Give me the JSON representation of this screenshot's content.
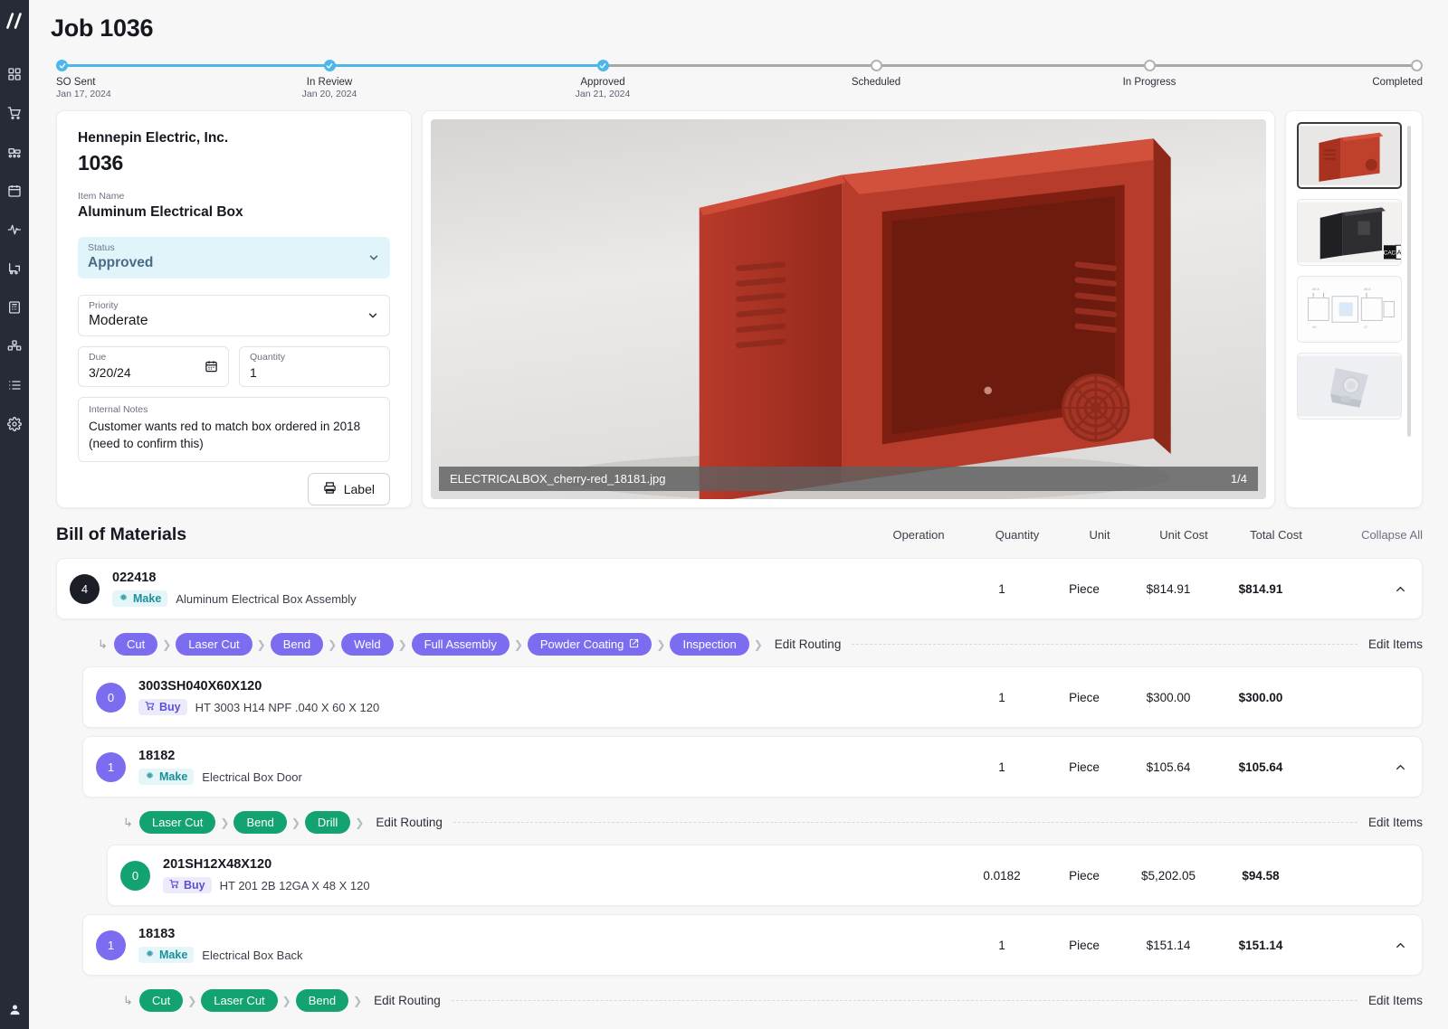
{
  "sidebar": {
    "logo": "slash-logo",
    "items": [
      {
        "name": "dashboard",
        "icon": "grid-icon"
      },
      {
        "name": "orders",
        "icon": "cart-icon"
      },
      {
        "name": "production",
        "icon": "conveyor-icon"
      },
      {
        "name": "schedule",
        "icon": "calendar-icon"
      },
      {
        "name": "analytics",
        "icon": "pulse-icon"
      },
      {
        "name": "shipping",
        "icon": "forklift-icon"
      },
      {
        "name": "estimating",
        "icon": "calculator-icon"
      },
      {
        "name": "inventory",
        "icon": "boxes-icon"
      },
      {
        "name": "lists",
        "icon": "list-icon"
      },
      {
        "name": "settings",
        "icon": "gear-icon"
      }
    ],
    "profile_icon": "user-icon"
  },
  "header": {
    "title": "Job 1036"
  },
  "stepper": {
    "fill_percent": 40,
    "accent_color": "#4cb7e8",
    "steps": [
      {
        "label": "SO Sent",
        "date": "Jan 17, 2024",
        "state": "done"
      },
      {
        "label": "In Review",
        "date": "Jan 20, 2024",
        "state": "done"
      },
      {
        "label": "Approved",
        "date": "Jan 21, 2024",
        "state": "current"
      },
      {
        "label": "Scheduled",
        "date": "",
        "state": "pending"
      },
      {
        "label": "In Progress",
        "date": "",
        "state": "pending"
      },
      {
        "label": "Completed",
        "date": "",
        "state": "pending"
      }
    ]
  },
  "detail": {
    "company": "Hennepin Electric, Inc.",
    "job_number": "1036",
    "item_name_label": "Item Name",
    "item_name": "Aluminum Electrical Box",
    "status_label": "Status",
    "status_value": "Approved",
    "status_bg": "#e0f4fa",
    "priority_label": "Priority",
    "priority_value": "Moderate",
    "due_label": "Due",
    "due_value": "3/20/24",
    "quantity_label": "Quantity",
    "quantity_value": "1",
    "notes_label": "Internal Notes",
    "notes_value": "Customer wants red to match box ordered in 2018 (need to confirm this)",
    "label_button": "Label"
  },
  "viewer": {
    "filename": "ELECTRICALBOX_cherry-red_18181.jpg",
    "counter": "1/4",
    "thumbnails": [
      {
        "name": "thumb-red-box",
        "selected": true
      },
      {
        "name": "thumb-cad-black",
        "selected": false
      },
      {
        "name": "thumb-flat-drawing",
        "selected": false
      },
      {
        "name": "thumb-bracket",
        "selected": false
      }
    ]
  },
  "bom": {
    "title": "Bill of Materials",
    "columns": [
      "Operation",
      "Quantity",
      "Unit",
      "Unit Cost",
      "Total Cost"
    ],
    "collapse_all": "Collapse All",
    "edit_routing": "Edit Routing",
    "edit_items": "Edit Items",
    "rows": [
      {
        "level": 0,
        "badge": "4",
        "badge_color": "dark",
        "code": "022418",
        "tag": "Make",
        "tag_type": "make",
        "description": "Aluminum Electrical Box Assembly",
        "quantity": "1",
        "unit": "Piece",
        "unit_cost": "$814.91",
        "total_cost": "$814.91",
        "expanded": true
      },
      {
        "level": 1,
        "badge": "0",
        "badge_color": "purple",
        "code": "3003SH040X60X120",
        "tag": "Buy",
        "tag_type": "buy",
        "description": "HT 3003 H14 NPF .040 X 60 X 120",
        "quantity": "1",
        "unit": "Piece",
        "unit_cost": "$300.00",
        "total_cost": "$300.00",
        "expanded": false
      },
      {
        "level": 1,
        "badge": "1",
        "badge_color": "purple",
        "code": "18182",
        "tag": "Make",
        "tag_type": "make",
        "description": "Electrical Box Door",
        "quantity": "1",
        "unit": "Piece",
        "unit_cost": "$105.64",
        "total_cost": "$105.64",
        "expanded": true
      },
      {
        "level": 2,
        "badge": "0",
        "badge_color": "green",
        "code": "201SH12X48X120",
        "tag": "Buy",
        "tag_type": "buy",
        "description": "HT 201 2B 12GA X 48 X 120",
        "quantity": "0.0182",
        "unit": "Piece",
        "unit_cost": "$5,202.05",
        "total_cost": "$94.58",
        "expanded": false
      },
      {
        "level": 1,
        "badge": "1",
        "badge_color": "purple",
        "code": "18183",
        "tag": "Make",
        "tag_type": "make",
        "description": "Electrical Box Back",
        "quantity": "1",
        "unit": "Piece",
        "unit_cost": "$151.14",
        "total_cost": "$151.14",
        "expanded": true
      }
    ],
    "routings": [
      {
        "after_row": 0,
        "level": 0,
        "color": "p",
        "chips": [
          {
            "label": "Cut"
          },
          {
            "label": "Laser Cut"
          },
          {
            "label": "Bend"
          },
          {
            "label": "Weld"
          },
          {
            "label": "Full Assembly"
          },
          {
            "label": "Powder Coating",
            "icon": "external-link-icon"
          },
          {
            "label": "Inspection"
          }
        ]
      },
      {
        "after_row": 2,
        "level": 1,
        "color": "g",
        "chips": [
          {
            "label": "Laser Cut"
          },
          {
            "label": "Bend"
          },
          {
            "label": "Drill"
          }
        ]
      },
      {
        "after_row": 4,
        "level": 1,
        "color": "g",
        "chips": [
          {
            "label": "Cut"
          },
          {
            "label": "Laser Cut"
          },
          {
            "label": "Bend"
          }
        ]
      }
    ]
  }
}
